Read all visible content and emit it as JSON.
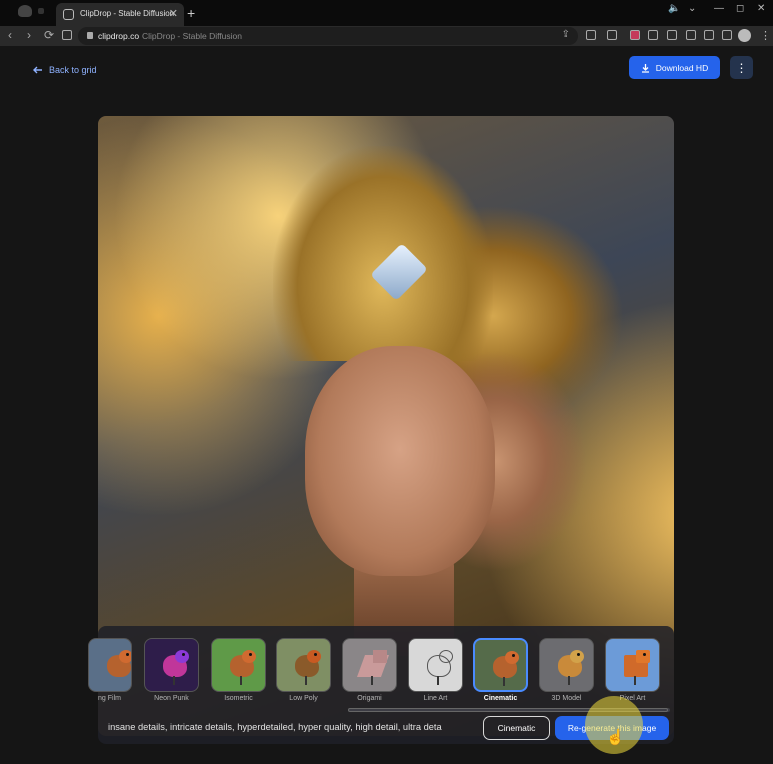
{
  "browser": {
    "tab_title": "ClipDrop - Stable Diffusion",
    "tab_close": "✕",
    "new_tab": "+",
    "url_host": "clipdrop.co",
    "url_title": "ClipDrop - Stable Diffusion",
    "nav_back": "‹",
    "nav_forward": "›",
    "reload": "⟳",
    "window_controls": [
      "—",
      "◻",
      "✕"
    ]
  },
  "header": {
    "back_label": "Back to grid",
    "download_label": "Download HD",
    "more_label": "⋮"
  },
  "styles": {
    "items": [
      {
        "label": "ng Film"
      },
      {
        "label": "Neon Punk"
      },
      {
        "label": "Isometric"
      },
      {
        "label": "Low Poly"
      },
      {
        "label": "Origami"
      },
      {
        "label": "Line Art"
      },
      {
        "label": "Cinematic",
        "selected": true
      },
      {
        "label": "3D Model"
      },
      {
        "label": "Pixel Art"
      }
    ]
  },
  "prompt": {
    "text": "insane details, intricate details, hyperdetailed, hyper quality, high detail, ultra deta",
    "style_chip": "Cinematic",
    "regenerate_label": "Re-generate this image"
  },
  "colors": {
    "accent": "#2563eb",
    "selected_border": "#4a8bff",
    "page_bg": "#151515"
  }
}
